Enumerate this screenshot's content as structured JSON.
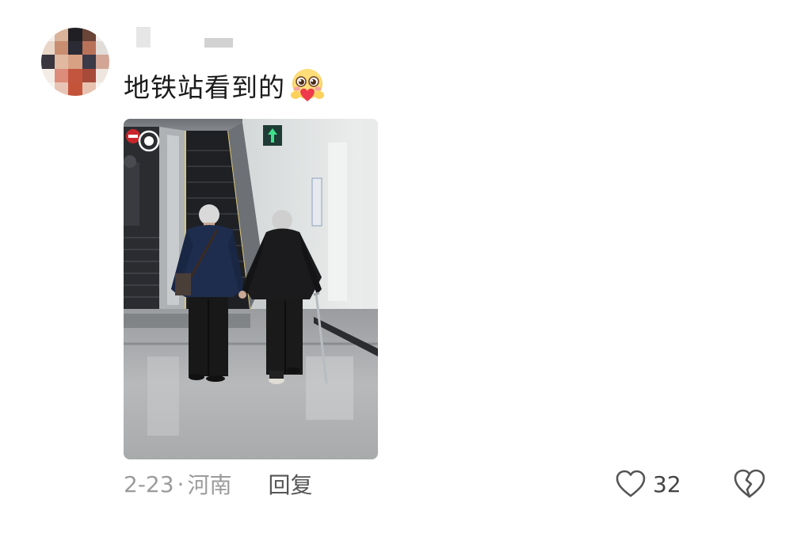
{
  "comment": {
    "text": "地铁站看到的",
    "emoji": "heart-eyes-hug-emoji",
    "time": "2-23",
    "separator": "·",
    "location": "河南",
    "reply_label": "回复"
  },
  "actions": {
    "like_count": "32",
    "like_icon": "heart-outline-icon",
    "dislike_icon": "broken-heart-icon"
  },
  "colors": {
    "text": "#1b1b1b",
    "meta": "#9b9b9b",
    "reply": "#555555",
    "icon": "#555555"
  }
}
